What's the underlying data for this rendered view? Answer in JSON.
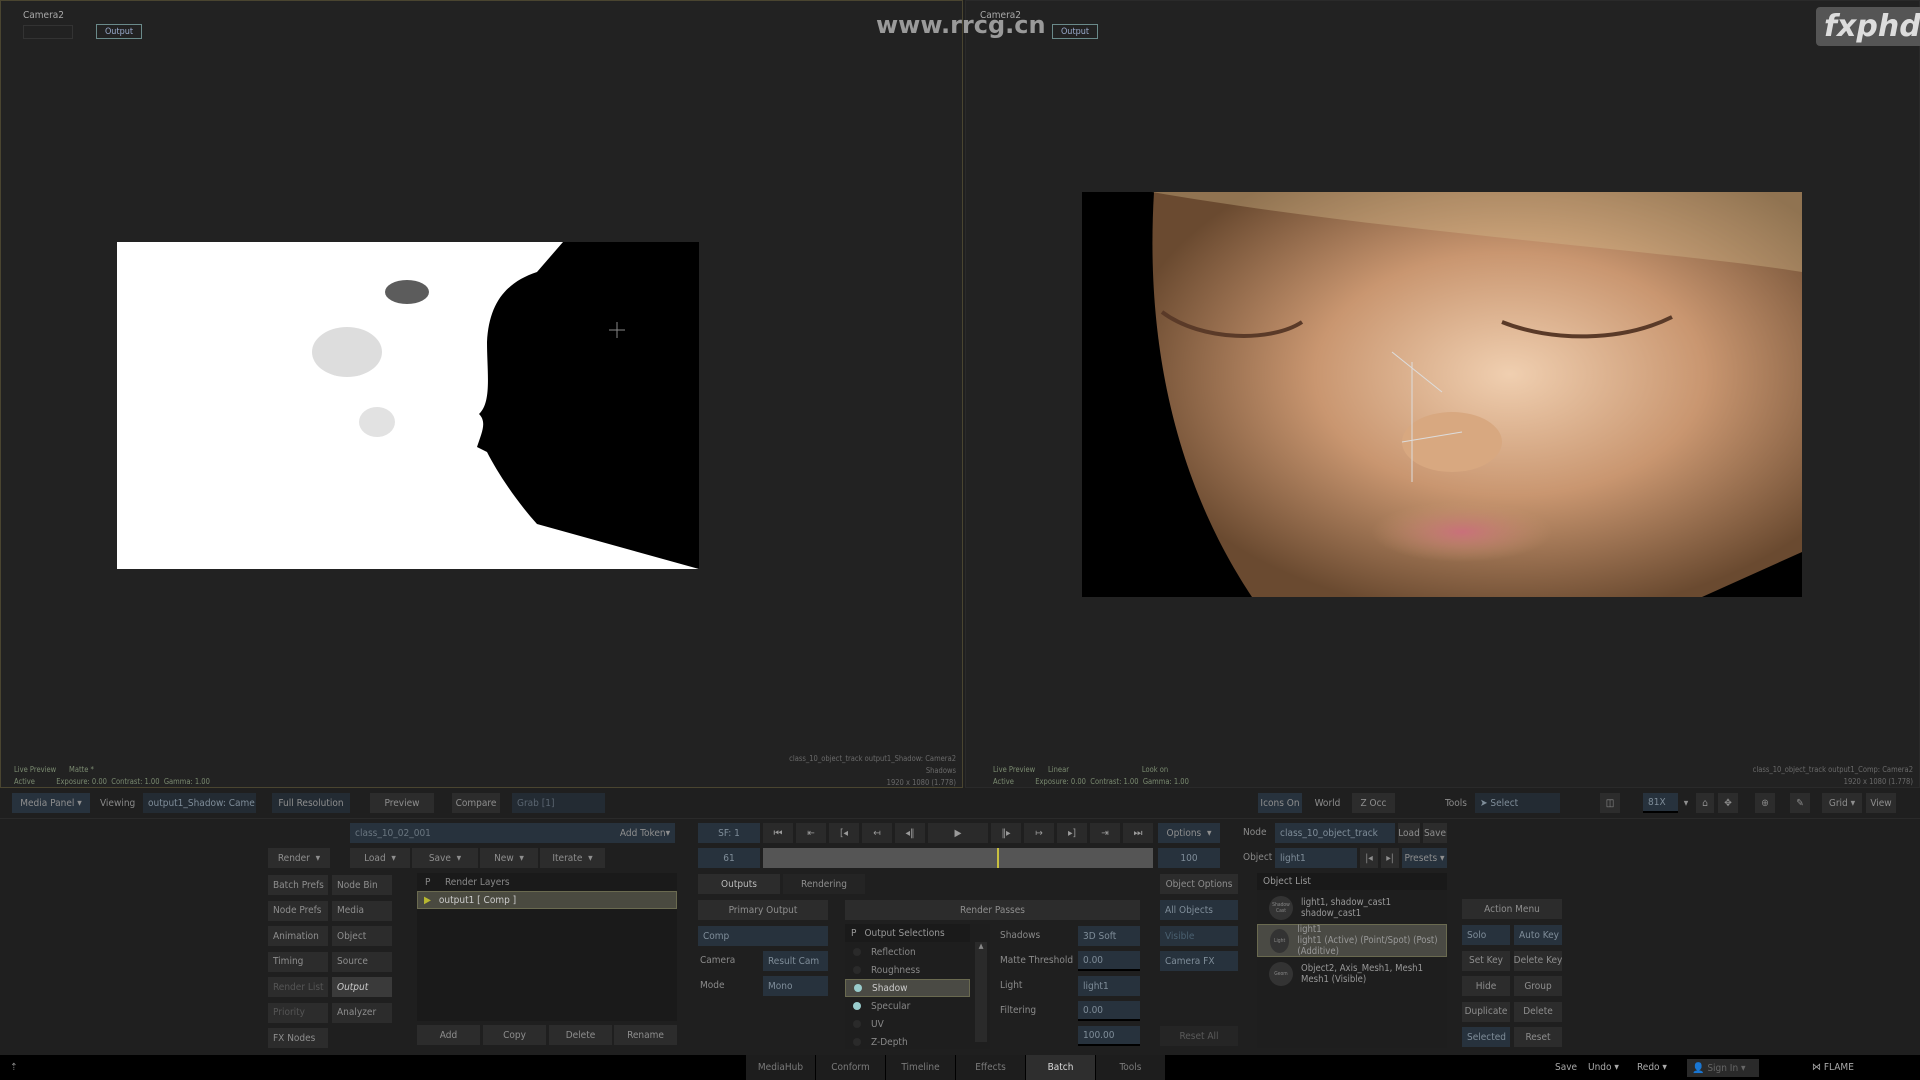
{
  "logo": "fxphd",
  "watermark": "www.rrcg.cn",
  "left_viewport": {
    "camera": "Camera2",
    "output_tab": "Output",
    "info_left": {
      "l1a": "Live Preview",
      "l1b": "Matte *",
      "l2a": "Active",
      "l2b": "Exposure: 0.00",
      "l2c": "Contrast: 1.00",
      "l2d": "Gamma: 1.00"
    },
    "info_right": [
      "class_10_object_track output1_Shadow: Camera2",
      "Shadows",
      "1920 x 1080 (1.778)"
    ]
  },
  "right_viewport": {
    "camera": "Camera2",
    "output_tab": "Output",
    "info_left": {
      "l1a": "Live Preview",
      "l1b": "Linear",
      "l1c": "Look on",
      "l2a": "Active",
      "l2b": "Exposure: 0.00",
      "l2c": "Contrast: 1.00",
      "l2d": "Gamma: 1.00"
    },
    "info_right": [
      "class_10_object_track output1_Comp: Camera2",
      "1920 x 1080 (1.778)"
    ]
  },
  "topbar": {
    "media_panel": "Media Panel",
    "viewing": "Viewing",
    "viewing_value": "output1_Shadow: Came",
    "full_res": "Full Resolution",
    "preview": "Preview",
    "compare": "Compare",
    "grab": "Grab [1]",
    "icons_on": "Icons On",
    "world": "World",
    "zocc": "Z Occ",
    "tools": "Tools",
    "select": "Select",
    "zoom": "81X",
    "grid": "Grid",
    "view": "View"
  },
  "batch": {
    "token_field": "class_10_02_001",
    "add_token": "Add Token",
    "render": "Render",
    "load": "Load",
    "save": "Save",
    "new": "New",
    "iterate": "Iterate",
    "grid": [
      [
        "Batch Prefs",
        "Node Bin"
      ],
      [
        "Node Prefs",
        "Media"
      ],
      [
        "Animation",
        "Object"
      ],
      [
        "Timing",
        "Source"
      ],
      [
        "Render List",
        "Output"
      ],
      [
        "Priority",
        "Analyzer"
      ],
      [
        "FX Nodes",
        ""
      ]
    ],
    "layers_header_p": "P",
    "layers_header": "Render Layers",
    "layer": "output1 [ Comp ]",
    "add": "Add",
    "copy": "Copy",
    "delete": "Delete",
    "rename": "Rename"
  },
  "transport": {
    "start_frame": "SF: 1",
    "current_frame": "61",
    "end_frame": "100",
    "options": "Options",
    "playhead_fraction": 0.6
  },
  "output_panel": {
    "tab_outputs": "Outputs",
    "tab_rendering": "Rendering",
    "primary_output": "Primary Output",
    "comp": "Comp",
    "camera_label": "Camera",
    "camera_value": "Result Cam",
    "mode_label": "Mode",
    "mode_value": "Mono",
    "render_passes": "Render Passes",
    "list_header_p": "P",
    "list_header": "Output Selections",
    "passes": [
      {
        "name": "Reflection",
        "on": false
      },
      {
        "name": "Roughness",
        "on": false
      },
      {
        "name": "Shadow",
        "on": true,
        "selected": true
      },
      {
        "name": "Specular",
        "on": true
      },
      {
        "name": "UV",
        "on": false
      },
      {
        "name": "Z-Depth",
        "on": false
      }
    ],
    "shadows_label": "Shadows",
    "shadows_value": "3D Soft",
    "matte_label": "Matte Threshold",
    "matte_value": "0.00",
    "light_label": "Light",
    "light_value": "light1",
    "filtering_label": "Filtering",
    "filtering_value": "0.00",
    "last_value": "100.00"
  },
  "object_options": {
    "title": "Object Options",
    "all_objects": "All Objects",
    "visible": "Visible",
    "camera_fx": "Camera FX",
    "reset_all": "Reset All"
  },
  "node": {
    "node_label": "Node",
    "node_value": "class_10_object_track",
    "load": "Load",
    "save": "Save",
    "object_label": "Object",
    "object_value": "light1",
    "presets": "Presets",
    "list_header": "Object List",
    "objects": [
      {
        "icon": "Shadow Cast",
        "l1": "light1, shadow_cast1",
        "l2": "shadow_cast1"
      },
      {
        "icon": "Light",
        "l1": "light1",
        "l2": "light1 (Active) (Point/Spot) (Post) (Additive)"
      },
      {
        "icon": "Geom",
        "l1": "Object2, Axis_Mesh1, Mesh1",
        "l2": "Mesh1 (Visible)"
      }
    ]
  },
  "action_menu": {
    "title": "Action Menu",
    "buttons": [
      "Solo",
      "Auto Key",
      "Set Key",
      "Delete Key",
      "Hide",
      "Group",
      "Duplicate",
      "Delete",
      "Selected",
      "Reset"
    ]
  },
  "statusbar": {
    "tabs": [
      "MediaHub",
      "Conform",
      "Timeline",
      "Effects",
      "Batch",
      "Tools"
    ],
    "active": "Batch",
    "save": "Save",
    "undo": "Undo",
    "redo": "Redo",
    "sign_in": "Sign In",
    "app": "FLAME"
  },
  "colors": {
    "accent": "#c8c040",
    "field": "#27323d",
    "bg": "#1f1f1f"
  }
}
